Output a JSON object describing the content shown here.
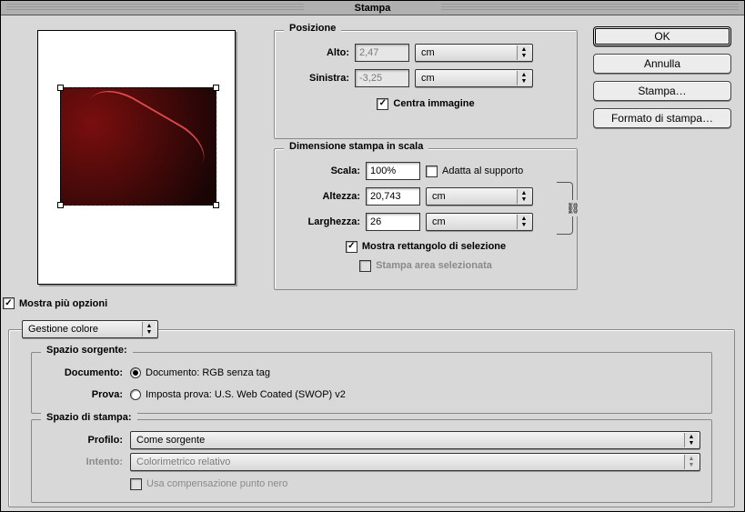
{
  "title": "Stampa",
  "buttons": {
    "ok": "OK",
    "cancel": "Annulla",
    "print": "Stampa…",
    "page_setup": "Formato di stampa…"
  },
  "position": {
    "title": "Posizione",
    "top_label": "Alto:",
    "top_value": "2,47",
    "top_unit": "cm",
    "left_label": "Sinistra:",
    "left_value": "-3,25",
    "left_unit": "cm",
    "center_label": "Centra immagine",
    "center_checked": true
  },
  "scale": {
    "title": "Dimensione stampa in scala",
    "scale_label": "Scala:",
    "scale_value": "100%",
    "fit_label": "Adatta al supporto",
    "fit_checked": false,
    "height_label": "Altezza:",
    "height_value": "20,743",
    "height_unit": "cm",
    "width_label": "Larghezza:",
    "width_value": "26",
    "width_unit": "cm",
    "show_bbox_label": "Mostra rettangolo di selezione",
    "show_bbox_checked": true,
    "print_sel_label": "Stampa area selezionata",
    "print_sel_enabled": false
  },
  "more_options": {
    "label": "Mostra più opzioni",
    "checked": true
  },
  "options_panel": {
    "selector": "Gestione colore",
    "source_space": {
      "title": "Spazio sorgente:",
      "document_label": "Documento:",
      "document_radio": "Documento:  RGB senza tag",
      "proof_label": "Prova:",
      "proof_radio": "Imposta prova:  U.S. Web Coated (SWOP) v2"
    },
    "print_space": {
      "title": "Spazio di stampa:",
      "profile_label": "Profilo:",
      "profile_value": "Come sorgente",
      "intent_label": "Intento:",
      "intent_value": "Colorimetrico relativo",
      "bpc_label": "Usa compensazione punto nero",
      "bpc_enabled": false
    }
  }
}
